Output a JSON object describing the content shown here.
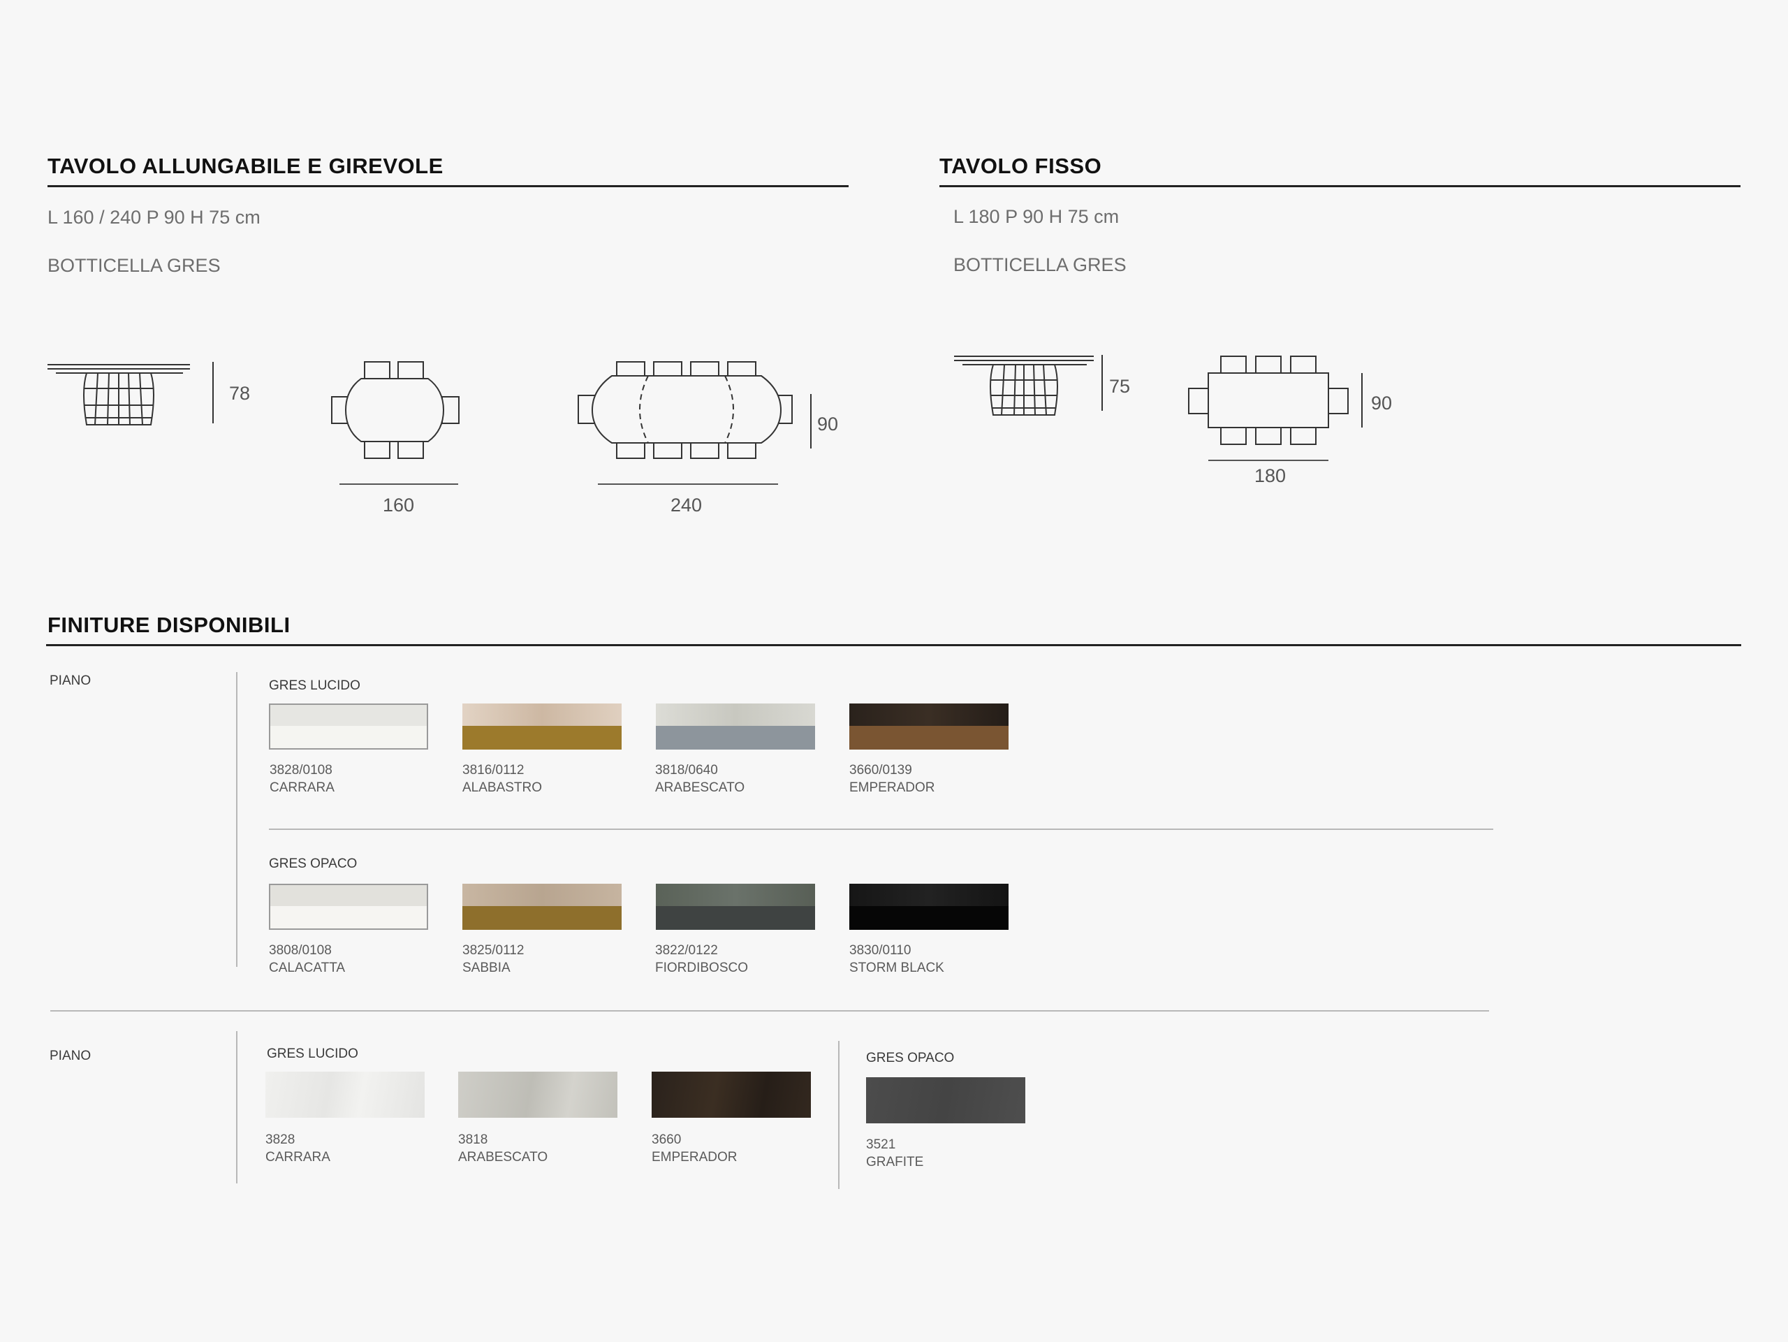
{
  "sections": {
    "allungabile": {
      "title": "TAVOLO ALLUNGABILE E GIREVOLE",
      "dimensions": "L 160 / 240 P 90 H 75 cm",
      "model": "BOTTICELLA GRES",
      "drawing_labels": {
        "height": "78",
        "closed_length": "160",
        "open_length": "240",
        "depth": "90"
      }
    },
    "fisso": {
      "title": "TAVOLO FISSO",
      "dimensions": "L 180 P 90 H 75 cm",
      "model": "BOTTICELLA GRES",
      "drawing_labels": {
        "height": "75",
        "depth": "90",
        "length": "180"
      }
    }
  },
  "finishes": {
    "title": "FINITURE DISPONIBILI",
    "group1": {
      "label": "PIANO",
      "lucido": {
        "label": "GRES LUCIDO",
        "items": [
          {
            "code": "3828/0108",
            "name": "CARRARA",
            "top": "#e6e6e2",
            "bottom": "#f5f5f1",
            "border": true
          },
          {
            "code": "3816/0112",
            "name": "ALABASTRO",
            "top": "#d9c7b5",
            "bottom": "#9c7a2c"
          },
          {
            "code": "3818/0640",
            "name": "ARABESCATO",
            "top": "#d3d3cc",
            "bottom": "#8d959c"
          },
          {
            "code": "3660/0139",
            "name": "EMPERADOR",
            "top": "#2b241f",
            "bottom": "#7a5532"
          }
        ]
      },
      "opaco": {
        "label": "GRES OPACO",
        "items": [
          {
            "code": "3808/0108",
            "name": "CALACATTA",
            "top": "#e2e1dc",
            "bottom": "#f6f5f2",
            "border": true
          },
          {
            "code": "3825/0112",
            "name": "SABBIA",
            "top": "#c2b09b",
            "bottom": "#8e6f2c"
          },
          {
            "code": "3822/0122",
            "name": "FIORDIBOSCO",
            "top": "#5e655c",
            "bottom": "#3f4342"
          },
          {
            "code": "3830/0110",
            "name": "STORM BLACK",
            "top": "#181818",
            "bottom": "#060606"
          }
        ]
      }
    },
    "group2": {
      "label": "PIANO",
      "lucido": {
        "label": "GRES LUCIDO",
        "items": [
          {
            "code": "3828",
            "name": "CARRARA",
            "top": "#ececea",
            "bottom": "#ececea"
          },
          {
            "code": "3818",
            "name": "ARABESCATO",
            "top": "#c6c5be",
            "bottom": "#c6c5be"
          },
          {
            "code": "3660",
            "name": "EMPERADOR",
            "top": "#2d241d",
            "bottom": "#2d241d"
          }
        ]
      },
      "opaco": {
        "label": "GRES OPACO",
        "items": [
          {
            "code": "3521",
            "name": "GRAFITE",
            "top": "#4a4a4a",
            "bottom": "#4a4a4a"
          }
        ]
      }
    }
  }
}
